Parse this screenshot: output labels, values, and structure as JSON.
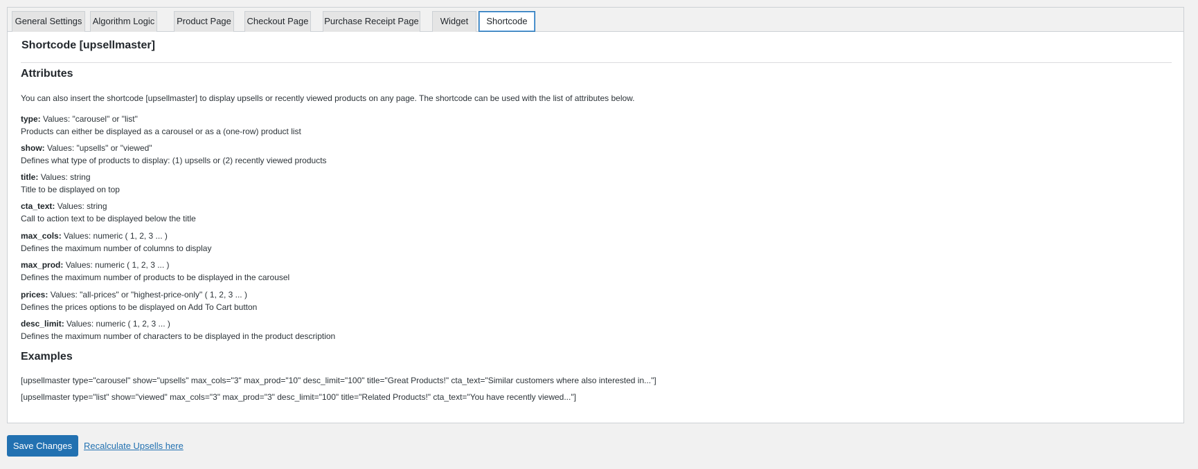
{
  "tabs": [
    {
      "label": "General Settings",
      "active": false
    },
    {
      "label": "Algorithm Logic",
      "active": false
    },
    {
      "label": "Product Page",
      "active": false
    },
    {
      "label": "Checkout Page",
      "active": false
    },
    {
      "label": "Purchase Receipt Page",
      "active": false
    },
    {
      "label": "Widget",
      "active": false
    },
    {
      "label": "Shortcode",
      "active": true
    }
  ],
  "section_title": "Shortcode [upsellmaster]",
  "attributes_heading": "Attributes",
  "intro": "You can also insert the shortcode [upsellmaster] to display upsells or recently viewed products on any page. The shortcode can be used with the list of attributes below.",
  "attributes": [
    {
      "name": "type:",
      "values": "Values: \"carousel\" or \"list\"",
      "description": "Products can either be displayed as a carousel or as a (one-row) product list"
    },
    {
      "name": "show:",
      "values": "Values: \"upsells\" or \"viewed\"",
      "description": "Defines what type of products to display: (1) upsells or (2) recently viewed products"
    },
    {
      "name": "title:",
      "values": "Values: string",
      "description": "Title to be displayed on top"
    },
    {
      "name": "cta_text:",
      "values": "Values: string",
      "description": "Call to action text to be displayed below the title"
    },
    {
      "name": "max_cols:",
      "values": "Values: numeric ( 1, 2, 3 ... )",
      "description": "Defines the maximum number of columns to display"
    },
    {
      "name": "max_prod:",
      "values": "Values: numeric ( 1, 2, 3 ... )",
      "description": "Defines the maximum number of products to be displayed in the carousel"
    },
    {
      "name": "prices:",
      "values": "Values: \"all-prices\" or \"highest-price-only\" ( 1, 2, 3 ... )",
      "description": "Defines the prices options to be displayed on Add To Cart button"
    },
    {
      "name": "desc_limit:",
      "values": "Values: numeric ( 1, 2, 3 ... )",
      "description": "Defines the maximum number of characters to be displayed in the product description"
    }
  ],
  "examples_heading": "Examples",
  "examples": [
    "[upsellmaster type=\"carousel\" show=\"upsells\" max_cols=\"3\" max_prod=\"10\" desc_limit=\"100\" title=\"Great Products!\" cta_text=\"Similar customers where also interested in...\"]",
    "[upsellmaster type=\"list\" show=\"viewed\" max_cols=\"3\" max_prod=\"3\" desc_limit=\"100\" title=\"Related Products!\" cta_text=\"You have recently viewed...\"]"
  ],
  "save_button": "Save Changes",
  "recalculate_link": "Recalculate Upsells here",
  "colors": {
    "primary": "#2271b1",
    "page_bg": "#f1f1f1",
    "panel_bg": "#ffffff",
    "border": "#ccd0d4"
  }
}
